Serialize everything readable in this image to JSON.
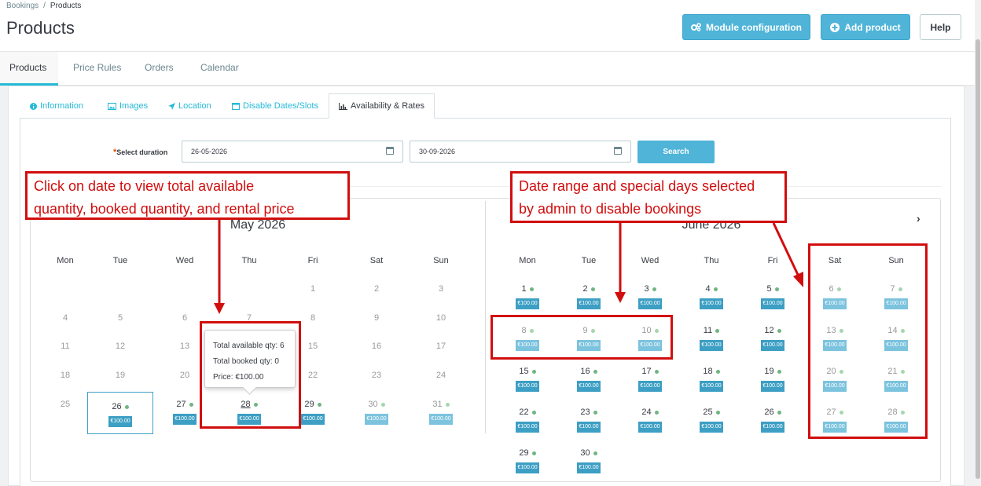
{
  "breadcrumb": {
    "parent": "Bookings",
    "current": "Products"
  },
  "page_title": "Products",
  "toolbar": {
    "module_config": "Module configuration",
    "add_product": "Add product",
    "help": "Help"
  },
  "nav_tabs": [
    "Products",
    "Price Rules",
    "Orders",
    "Calendar"
  ],
  "sub_tabs": [
    "Information",
    "Images",
    "Location",
    "Disable Dates/Slots",
    "Availability & Rates"
  ],
  "duration": {
    "label": "Select duration",
    "from": "26-05-2026",
    "to": "30-09-2026",
    "search": "Search"
  },
  "calendar": {
    "left_title": "May 2026",
    "right_title": "June 2026",
    "weekdays": [
      "Mon",
      "Tue",
      "Wed",
      "Thu",
      "Fri",
      "Sat",
      "Sun"
    ],
    "price": "€100.00"
  },
  "tooltip": {
    "available": "Total available qty: 6",
    "booked": "Total booked qty: 0",
    "price": "Price: €100.00"
  },
  "annotations": {
    "left_line1": "Click on date to view total available",
    "left_line2": "quantity, booked quantity, and rental price",
    "right_line1": "Date range and special days selected",
    "right_line2": "by admin to disable bookings"
  },
  "colors": {
    "primary": "#4fb4d8",
    "price_badge": "#3d9fc4",
    "disabled_badge": "#7cc3de",
    "annotation": "#d10e0e",
    "available_dot": "#70b580"
  }
}
